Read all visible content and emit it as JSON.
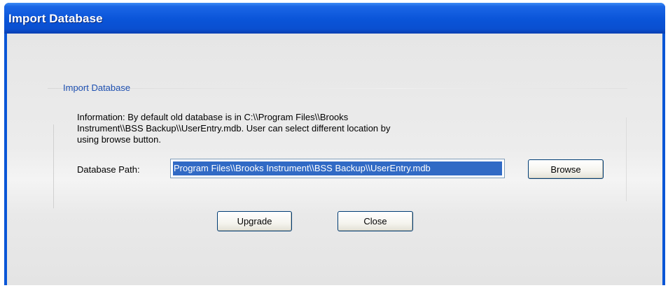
{
  "window": {
    "title": "Import Database"
  },
  "group": {
    "label": "Import Database",
    "info_line1": "Information:  By default old database is in C:\\\\Program Files\\\\Brooks",
    "info_line2": "Instrument\\\\BSS Backup\\\\UserEntry.mdb. User can select different location by",
    "info_line3": "using browse button.",
    "path_label": "Database Path:",
    "path_value": "Program Files\\\\Brooks Instrument\\\\BSS Backup\\\\UserEntry.mdb"
  },
  "buttons": {
    "browse": "Browse",
    "upgrade": "Upgrade",
    "close": "Close"
  },
  "colors": {
    "titlebar": "#0a54d8",
    "selection": "#316ac5",
    "group_label": "#1d4fb0"
  }
}
